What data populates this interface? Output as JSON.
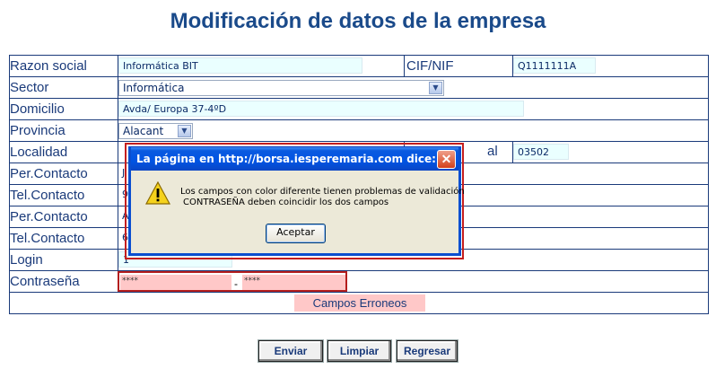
{
  "page": {
    "title": "Modificación de datos de la empresa"
  },
  "form": {
    "razon_social": {
      "label": "Razon social",
      "value": "Informática BIT"
    },
    "cif": {
      "label": "CIF/NIF",
      "value": "Q1111111A"
    },
    "sector": {
      "label": "Sector",
      "value": "Informática"
    },
    "domicilio": {
      "label": "Domicilio",
      "value": "Avda/ Europa 37-4ºD"
    },
    "provincia": {
      "label": "Provincia",
      "value": "Alacant"
    },
    "localidad": {
      "label": "Localidad"
    },
    "cp": {
      "label_fragment": "al",
      "value": "03502"
    },
    "per_contacto_1": {
      "label": "Per.Contacto",
      "value_fragment": "J"
    },
    "tel_contacto_1": {
      "label": "Tel.Contacto",
      "value_fragment": "9"
    },
    "per_contacto_2": {
      "label": "Per.Contacto",
      "value_fragment": "A"
    },
    "tel_contacto_2": {
      "label": "Tel.Contacto",
      "value_fragment": "6"
    },
    "login": {
      "label": "Login",
      "value": "1"
    },
    "contrasena": {
      "label": "Contraseña",
      "value1": "****",
      "separator": "-",
      "value2": "****"
    },
    "error_message": "Campos Erroneos"
  },
  "buttons": {
    "enviar": "Enviar",
    "limpiar": "Limpiar",
    "regresar": "Regresar"
  },
  "dialog": {
    "title": "La página en http://borsa.iesperemaria.com dice:",
    "message_line1": "Los campos con color diferente tienen problemas de validación",
    "message_line2": "CONTRASEÑA deben coincidir los dos campos",
    "ok": "Aceptar",
    "close_symbol": "✕"
  },
  "colors": {
    "title": "#1a4a8a",
    "error_bg": "#ffc8c8",
    "input_bg": "#eaffff",
    "dialog_title": "#0054e3"
  }
}
